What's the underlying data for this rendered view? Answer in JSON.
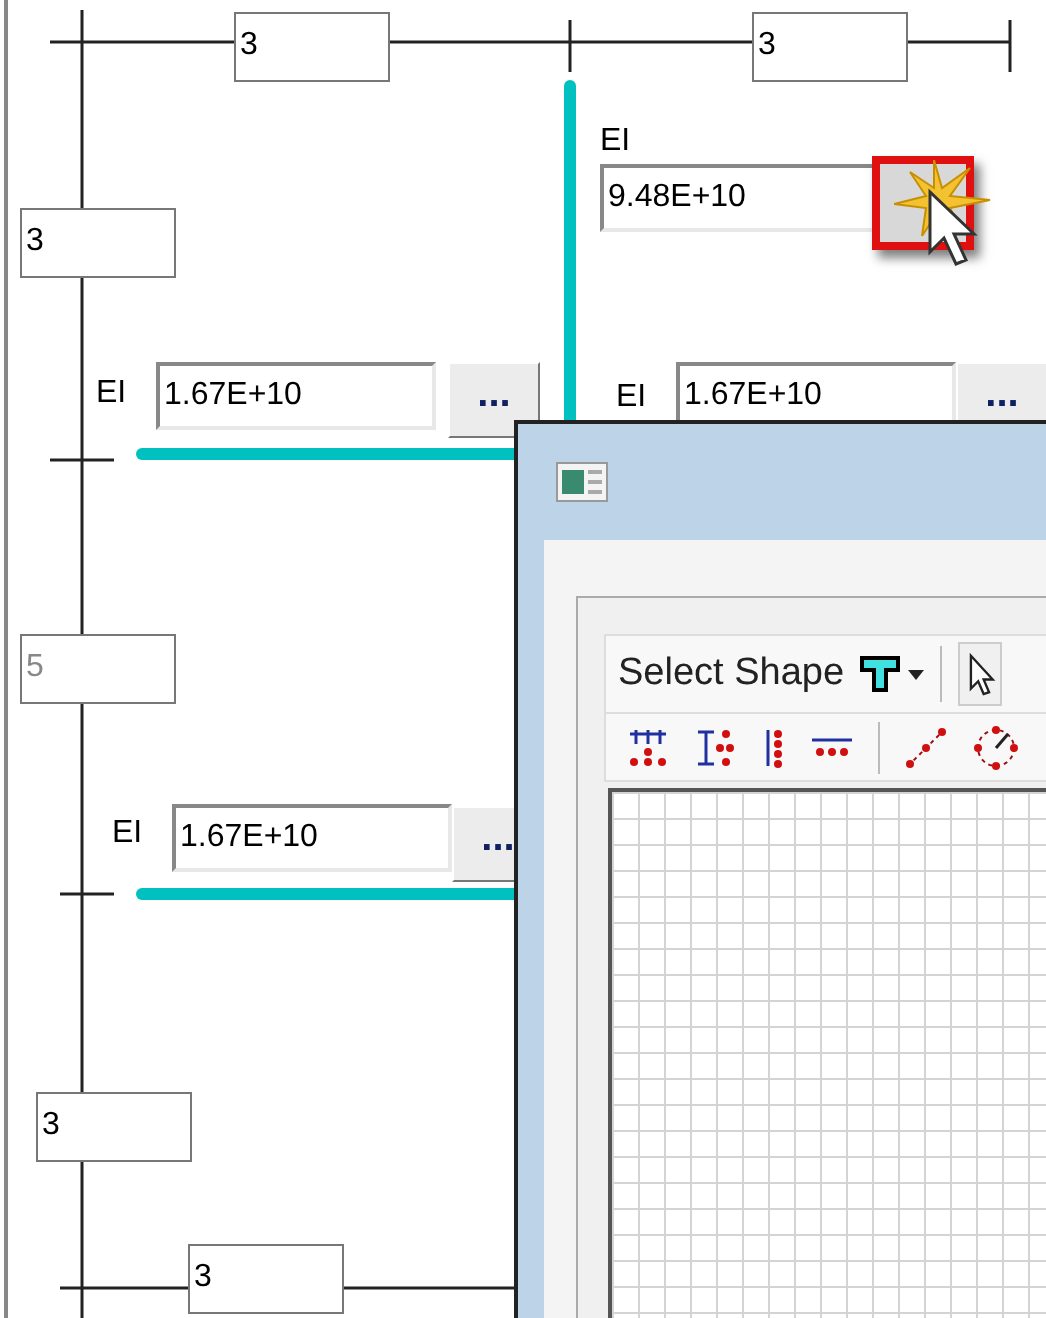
{
  "diagram": {
    "dimension_boxes": [
      {
        "value": "3",
        "disabled": false
      },
      {
        "value": "3",
        "disabled": false
      },
      {
        "value": "3",
        "disabled": false
      },
      {
        "value": "5",
        "disabled": true
      },
      {
        "value": "3",
        "disabled": false
      },
      {
        "value": "3",
        "disabled": false
      }
    ],
    "stiffness_fields": [
      {
        "label": "EI",
        "value": "9.48E+10",
        "highlighted": true
      },
      {
        "label": "EI",
        "value": "1.67E+10",
        "button": "...",
        "highlighted": false
      },
      {
        "label": "EI",
        "value": "1.67E+10",
        "button": "...",
        "highlighted": false
      },
      {
        "label": "EI",
        "value": "1.67E+10",
        "button": "...",
        "highlighted": false
      }
    ]
  },
  "dialog": {
    "toolbar": {
      "shape_dropdown": "Select Shape"
    }
  }
}
